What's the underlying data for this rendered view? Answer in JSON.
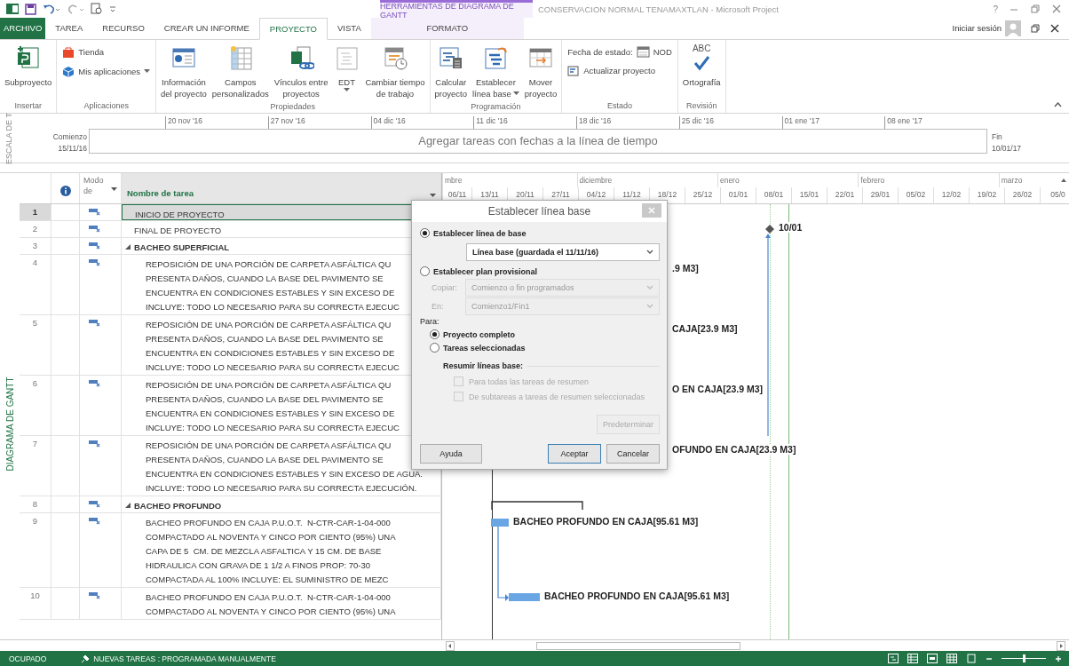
{
  "window": {
    "title": "CONSERVACION NORMAL TENAMAXTLAN - Microsoft Project",
    "help": "?"
  },
  "contextual_tab": {
    "label": "HERRAMIENTAS DE DIAGRAMA DE GANTT"
  },
  "tabs": [
    {
      "label": "ARCHIVO",
      "kind": "file",
      "selected": false
    },
    {
      "label": "TAREA",
      "kind": "normal",
      "selected": false
    },
    {
      "label": "RECURSO",
      "kind": "normal",
      "selected": false
    },
    {
      "label": "CREAR UN INFORME",
      "kind": "normal",
      "selected": false
    },
    {
      "label": "PROYECTO",
      "kind": "normal",
      "selected": true
    },
    {
      "label": "VISTA",
      "kind": "normal",
      "selected": false
    },
    {
      "label": "FORMATO",
      "kind": "contextual",
      "selected": false
    }
  ],
  "account": {
    "label": "Iniciar sesión"
  },
  "ribbon": {
    "groups": [
      {
        "label": "Insertar",
        "items": [
          {
            "kind": "large",
            "lines": [
              "Subproyecto"
            ],
            "dropdown": false
          }
        ]
      },
      {
        "label": "Aplicaciones",
        "items": [
          {
            "kind": "small",
            "lines": [
              "Tienda"
            ],
            "dropdown": false
          },
          {
            "kind": "small",
            "lines": [
              "Mis aplicaciones"
            ],
            "dropdown": true
          }
        ]
      },
      {
        "label": "Propiedades",
        "items": [
          {
            "kind": "large",
            "lines": [
              "Información",
              "del proyecto"
            ],
            "dropdown": false
          },
          {
            "kind": "large",
            "lines": [
              "Campos",
              "personalizados"
            ],
            "dropdown": false
          },
          {
            "kind": "large",
            "lines": [
              "Vínculos entre",
              "proyectos"
            ],
            "dropdown": false
          },
          {
            "kind": "large",
            "lines": [
              "EDT"
            ],
            "dropdown": true
          },
          {
            "kind": "large",
            "lines": [
              "Cambiar tiempo",
              "de trabajo"
            ],
            "dropdown": false
          }
        ]
      },
      {
        "label": "Programación",
        "items": [
          {
            "kind": "large",
            "lines": [
              "Calcular",
              "proyecto"
            ],
            "dropdown": false
          },
          {
            "kind": "large",
            "lines": [
              "Establecer",
              "línea base"
            ],
            "dropdown": true
          },
          {
            "kind": "large",
            "lines": [
              "Mover",
              "proyecto"
            ],
            "dropdown": false
          }
        ]
      },
      {
        "label": "Estado",
        "items": [
          {
            "kind": "status",
            "lines": [
              "Fecha de estado:"
            ],
            "value": "NOD"
          },
          {
            "kind": "small",
            "lines": [
              "Actualizar proyecto"
            ],
            "dropdown": false
          }
        ]
      },
      {
        "label": "Revisión",
        "items": [
          {
            "kind": "spell",
            "badge": "ABC",
            "lines": [
              "Ortografía"
            ],
            "dropdown": false
          }
        ]
      }
    ]
  },
  "timeline": {
    "label": "ESCALA DE T",
    "start_label": "Comienzo",
    "start_date": "15/11/16",
    "end_label": "Fin",
    "end_date": "10/01/17",
    "message": "Agregar tareas con fechas a la línea de tiempo",
    "ticks": [
      "20 nov '16",
      "27 nov '16",
      "04 dic '16",
      "11 dic '16",
      "18 dic '16",
      "25 dic '16",
      "01 ene '17",
      "08 ene '17"
    ]
  },
  "view_bar": {
    "label": "DIAGRAMA DE GANTT"
  },
  "table": {
    "mode_column": "Modo de",
    "name_column": "Nombre de tarea"
  },
  "tasks": [
    {
      "id": "1",
      "kind": "task",
      "selected": true,
      "name": [
        "INICIO DE PROYECTO"
      ]
    },
    {
      "id": "2",
      "kind": "task",
      "selected": false,
      "name": [
        "FINAL DE PROYECTO"
      ],
      "gantt": {
        "kind": "milestone",
        "label": "10/01"
      }
    },
    {
      "id": "3",
      "kind": "summary",
      "selected": false,
      "expanded": true,
      "name": [
        "BACHEO SUPERFICIAL"
      ],
      "children": [
        {
          "id": "4",
          "kind": "task",
          "selected": false,
          "name": [
            "REPOSICIÓN DE UNA PORCIÓN DE CARPETA ASFÁLTICA QU",
            "PRESENTA DAÑOS, CUANDO LA BASE DEL PAVIMENTO SE",
            "ENCUENTRA EN CONDICIONES ESTABLES Y SIN EXCESO DE",
            "INCLUYE: TODO LO NECESARIO PARA SU CORRECTA EJECUC"
          ],
          "gantt": {
            "kind": "label",
            "label": ".9 M3]"
          }
        },
        {
          "id": "5",
          "kind": "task",
          "selected": false,
          "name": [
            "REPOSICIÓN DE UNA PORCIÓN DE CARPETA ASFÁLTICA QU",
            "PRESENTA DAÑOS, CUANDO LA BASE DEL PAVIMENTO SE",
            "ENCUENTRA EN CONDICIONES ESTABLES Y SIN EXCESO DE",
            "INCLUYE: TODO LO NECESARIO PARA SU CORRECTA EJECUC"
          ],
          "gantt": {
            "kind": "label",
            "label": "CAJA[23.9 M3]"
          }
        },
        {
          "id": "6",
          "kind": "task",
          "selected": false,
          "name": [
            "REPOSICIÓN DE UNA PORCIÓN DE CARPETA ASFÁLTICA QU",
            "PRESENTA DAÑOS, CUANDO LA BASE DEL PAVIMENTO SE",
            "ENCUENTRA EN CONDICIONES ESTABLES Y SIN EXCESO DE",
            "INCLUYE: TODO LO NECESARIO PARA SU CORRECTA EJECUC"
          ],
          "gantt": {
            "kind": "label",
            "label": "O EN CAJA[23.9 M3]"
          }
        },
        {
          "id": "7",
          "kind": "task",
          "selected": false,
          "name": [
            "REPOSICIÓN DE UNA PORCIÓN DE CARPETA ASFÁLTICA QU",
            "PRESENTA DAÑOS, CUANDO LA BASE DEL PAVIMENTO SE",
            "ENCUENTRA EN CONDICIONES ESTABLES Y SIN EXCESO DE AGUA.",
            "INCLUYE: TODO LO NECESARIO PARA SU CORRECTA EJECUCIÓN."
          ],
          "gantt": {
            "kind": "label",
            "label": "OFUNDO EN CAJA[23.9 M3]"
          }
        }
      ]
    },
    {
      "id": "8",
      "kind": "summary",
      "selected": false,
      "expanded": true,
      "name": [
        "BACHEO PROFUNDO"
      ],
      "gantt": {
        "kind": "summary"
      },
      "children": [
        {
          "id": "9",
          "kind": "task",
          "selected": false,
          "name": [
            "BACHEO PROFUNDO EN CAJA P.U.O.T.  N-CTR-CAR-1-04-000",
            "COMPACTADO AL NOVENTA Y CINCO POR CIENTO (95%) UNA",
            "CAPA DE 5  CM. DE MEZCLA ASFALTICA Y 15 CM. DE BASE",
            "HIDRAULICA CON GRAVA DE 1 1/2 A FINOS PROP: 70-30",
            "COMPACTADA AL 100% INCLUYE: EL SUMINISTRO DE MEZC"
          ],
          "gantt": {
            "kind": "bar",
            "label": "BACHEO PROFUNDO EN CAJA[95.61 M3]"
          }
        },
        {
          "id": "10",
          "kind": "task",
          "selected": false,
          "name": [
            "BACHEO PROFUNDO EN CAJA P.U.O.T.  N-CTR-CAR-1-04-000",
            "COMPACTADO AL NOVENTA Y CINCO POR CIENTO (95%) UNA"
          ],
          "gantt": {
            "kind": "bar",
            "label": "BACHEO PROFUNDO EN CAJA[95.61 M3]"
          }
        }
      ]
    }
  ],
  "gantt": {
    "months": [
      {
        "label": "mbre"
      },
      {
        "label": "diciembre"
      },
      {
        "label": "enero"
      },
      {
        "label": "febrero"
      },
      {
        "label": "marzo"
      }
    ],
    "weeks": [
      "06/11",
      "13/11",
      "20/11",
      "27/11",
      "04/12",
      "11/12",
      "18/12",
      "25/12",
      "01/01",
      "08/01",
      "15/01",
      "22/01",
      "29/01",
      "05/02",
      "12/02",
      "19/02",
      "26/02",
      "05/0"
    ]
  },
  "dialog": {
    "title": "Establecer línea base",
    "modes": [
      {
        "label": "Establecer línea de base",
        "selected": true
      },
      {
        "label": "Establecer plan provisional",
        "selected": false
      }
    ],
    "baseline": {
      "value": "Línea base (guardada el 11/11/16)"
    },
    "interim_fields": [
      {
        "label": "Copiar:",
        "value": "Comienzo o fin programados",
        "disabled": true
      },
      {
        "label": "En:",
        "value": "Comienzo1/Fin1",
        "disabled": true
      }
    ],
    "scope_label": "Para:",
    "scope": [
      {
        "label": "Proyecto completo",
        "selected": true
      },
      {
        "label": "Tareas seleccionadas",
        "selected": false
      }
    ],
    "rollup_label": "Resumir líneas base:",
    "rollup": [
      {
        "label": "Para todas las tareas de resumen",
        "checked": false,
        "disabled": true
      },
      {
        "label": "De subtareas a tareas de resumen seleccionadas",
        "checked": false,
        "disabled": true
      }
    ],
    "buttons": [
      {
        "label": "Predeterminar",
        "kind": "extra",
        "disabled": true
      },
      {
        "label": "Ayuda",
        "kind": "help",
        "disabled": false
      },
      {
        "label": "Aceptar",
        "kind": "primary",
        "disabled": false
      },
      {
        "label": "Cancelar",
        "kind": "secondary",
        "disabled": false
      }
    ]
  },
  "status_bar": {
    "mode": "OCUPADO",
    "new_tasks": "NUEVAS TAREAS : PROGRAMADA MANUALMENTE",
    "zoom": {
      "level": 0.5
    }
  }
}
